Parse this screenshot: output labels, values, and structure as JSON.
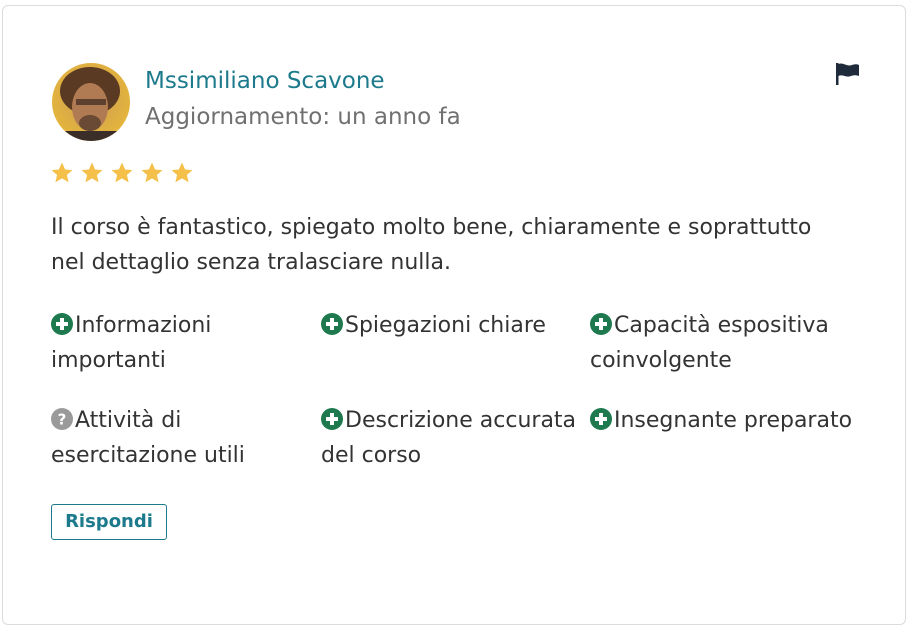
{
  "review": {
    "author": "Mssimiliano Scavone",
    "updated": "Aggiornamento: un anno fa",
    "rating": 5,
    "max_rating": 5,
    "text": "Il corso è fantastico, spiegato molto bene, chiaramente e soprattutto nel dettaglio senza tralasciare nulla.",
    "icons": {
      "avatar": "user-photo-avatar",
      "flag": "flag-icon",
      "star": "star-icon"
    }
  },
  "tags": [
    {
      "label": "Informazioni importanti",
      "icon": "plus-circle-icon"
    },
    {
      "label": "Spiegazioni chiare",
      "icon": "plus-circle-icon"
    },
    {
      "label": "Capacità espositiva coinvolgente",
      "icon": "plus-circle-icon"
    },
    {
      "label": "Attività di esercitazione utili",
      "icon": "question-circle-icon"
    },
    {
      "label": "Descrizione accurata del corso",
      "icon": "plus-circle-icon"
    },
    {
      "label": "Insegnante preparato",
      "icon": "plus-circle-icon"
    }
  ],
  "actions": {
    "reply_label": "Rispondi"
  },
  "colors": {
    "accent": "#1c7a8c",
    "star": "#f5c04a",
    "positive": "#1e7a4e",
    "neutral": "#9a9a9a"
  }
}
